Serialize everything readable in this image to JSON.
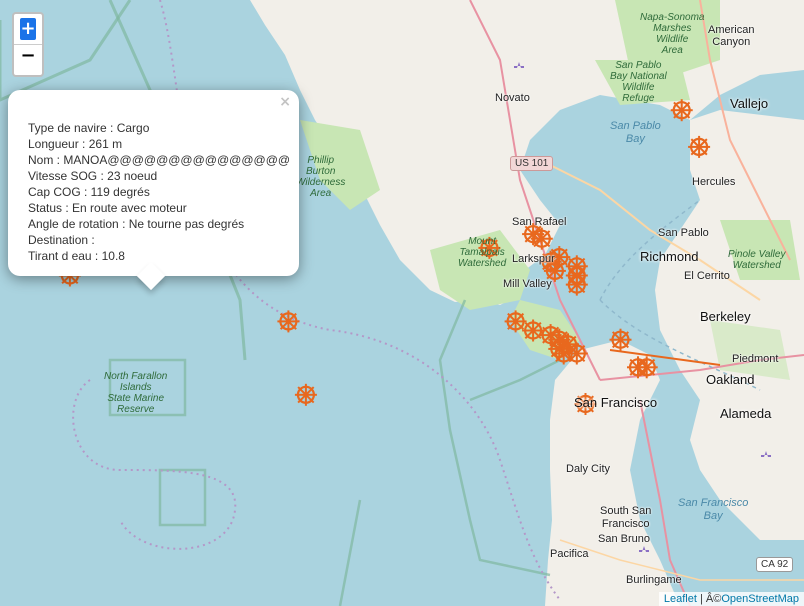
{
  "popup": {
    "lines": [
      "Type de navire : Cargo",
      "Longueur : 261 m",
      "Nom : MANOA@@@@@@@@@@@@@@@",
      "Vitesse SOG : 23 noeud",
      "Cap COG : 119 degrés",
      "Status : En route avec moteur",
      "Angle de rotation : Ne tourne pas degrés",
      "Destination :",
      "Tirant d eau : 10.8"
    ],
    "close_label": "×"
  },
  "zoom": {
    "in_label": "+",
    "out_label": "−"
  },
  "attribution": {
    "leaflet": "Leaflet",
    "separator": " | Â©",
    "osm": "OpenStreetMap"
  },
  "labels": {
    "napa_sonoma": "Napa-Sonoma\nMarshes\nWildlife\nArea",
    "american_canyon": "American\nCanyon",
    "san_pablo_refuge": "San Pablo\nBay National\nWildlife\nRefuge",
    "vallejo": "Vallejo",
    "novato": "Novato",
    "san_pablo_bay": "San Pablo\nBay",
    "us101": "US 101",
    "phillip_burton": "Phillip\nBurton\nWilderness\nArea",
    "hercules": "Hercules",
    "san_rafael": "San Rafael",
    "san_pablo": "San Pablo",
    "mount_tamalpais": "Mount\nTamalpais\nWatershed",
    "larkspur": "Larkspur",
    "richmond": "Richmond",
    "el_cerrito": "El Cerrito",
    "pinole_valley": "Pinole Valley\nWatershed",
    "mill_valley": "Mill Valley",
    "berkeley": "Berkeley",
    "piedmont": "Piedmont",
    "north_farallon": "North Farallon\nIslands\nState Marine\nReserve",
    "oakland": "Oakland",
    "san_francisco": "San Francisco",
    "alameda": "Alameda",
    "daly_city": "Daly City",
    "sf_bay": "San Francisco\nBay",
    "south_sf": "South San\nFrancisco",
    "san_bruno": "San Bruno",
    "pacifica": "Pacifica",
    "ca92": "CA 92",
    "burlingame": "Burlingame"
  },
  "colors": {
    "water": "#aad3df",
    "land": "#f2efe9",
    "park": "#c8e6b4",
    "marker": "#e8681e"
  },
  "markers": [
    {
      "lon": -122.28,
      "lat": 38.1
    },
    {
      "lon": -122.26,
      "lat": 38.06
    },
    {
      "lon": -122.5,
      "lat": 37.95
    },
    {
      "lon": -122.44,
      "lat": 37.96
    },
    {
      "lon": -122.45,
      "lat": 37.965
    },
    {
      "lon": -122.42,
      "lat": 37.94
    },
    {
      "lon": -122.43,
      "lat": 37.935
    },
    {
      "lon": -122.425,
      "lat": 37.925
    },
    {
      "lon": -122.4,
      "lat": 37.93
    },
    {
      "lon": -122.4,
      "lat": 37.92
    },
    {
      "lon": -122.4,
      "lat": 37.91
    },
    {
      "lon": -122.47,
      "lat": 37.87
    },
    {
      "lon": -122.45,
      "lat": 37.86
    },
    {
      "lon": -122.43,
      "lat": 37.855
    },
    {
      "lon": -122.42,
      "lat": 37.85
    },
    {
      "lon": -122.41,
      "lat": 37.845
    },
    {
      "lon": -122.42,
      "lat": 37.84
    },
    {
      "lon": -122.415,
      "lat": 37.835
    },
    {
      "lon": -122.4,
      "lat": 37.835
    },
    {
      "lon": -122.35,
      "lat": 37.85
    },
    {
      "lon": -122.33,
      "lat": 37.82
    },
    {
      "lon": -122.32,
      "lat": 37.82
    },
    {
      "lon": -122.39,
      "lat": 37.78
    },
    {
      "lon": -122.71,
      "lat": 37.79
    },
    {
      "lon": -122.73,
      "lat": 37.87
    },
    {
      "lon": -122.98,
      "lat": 37.92
    }
  ]
}
